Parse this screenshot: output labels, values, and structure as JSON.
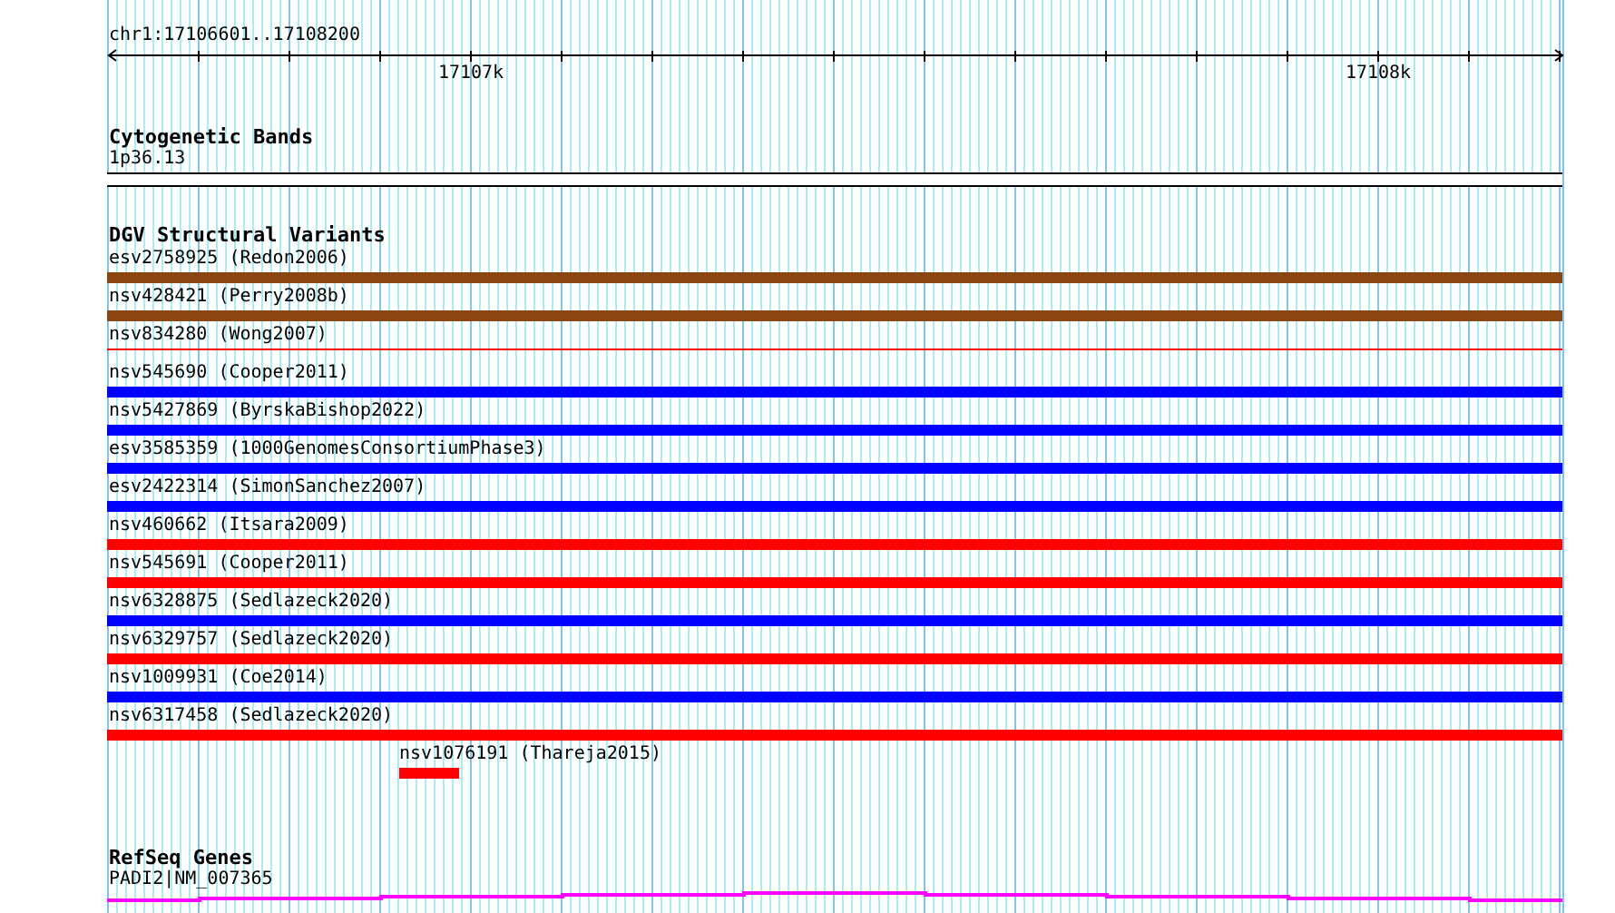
{
  "ruler": {
    "region": "chr1:17106601..17108200",
    "tick_labels": [
      "17107k",
      "17108k"
    ]
  },
  "cytogenetic_bands": {
    "title": "Cytogenetic Bands",
    "band": "1p36.13"
  },
  "dgv": {
    "title": "DGV Structural Variants",
    "variants": [
      {
        "label": "esv2758925 (Redon2006)",
        "color": "#8b4513",
        "kind": "bar"
      },
      {
        "label": "nsv428421 (Perry2008b)",
        "color": "#8b4513",
        "kind": "bar"
      },
      {
        "label": "nsv834280 (Wong2007)",
        "color": "#ff0000",
        "kind": "thin"
      },
      {
        "label": "nsv545690 (Cooper2011)",
        "color": "#0000ff",
        "kind": "bar"
      },
      {
        "label": "nsv5427869 (ByrskaBishop2022)",
        "color": "#0000ff",
        "kind": "bar"
      },
      {
        "label": "esv3585359 (1000GenomesConsortiumPhase3)",
        "color": "#0000ff",
        "kind": "bar"
      },
      {
        "label": "esv2422314 (SimonSanchez2007)",
        "color": "#0000ff",
        "kind": "bar"
      },
      {
        "label": "nsv460662 (Itsara2009)",
        "color": "#ff0000",
        "kind": "bar"
      },
      {
        "label": "nsv545691 (Cooper2011)",
        "color": "#ff0000",
        "kind": "bar"
      },
      {
        "label": "nsv6328875 (Sedlazeck2020)",
        "color": "#0000ff",
        "kind": "bar"
      },
      {
        "label": "nsv6329757 (Sedlazeck2020)",
        "color": "#ff0000",
        "kind": "bar"
      },
      {
        "label": "nsv1009931 (Coe2014)",
        "color": "#0000ff",
        "kind": "bar"
      },
      {
        "label": "nsv6317458 (Sedlazeck2020)",
        "color": "#ff0000",
        "kind": "bar"
      },
      {
        "label": "nsv1076191 (Thareja2015)",
        "color": "#ff0000",
        "kind": "short"
      }
    ]
  },
  "refseq": {
    "title": "RefSeq Genes",
    "gene": "PADI2|NM_007365"
  }
}
